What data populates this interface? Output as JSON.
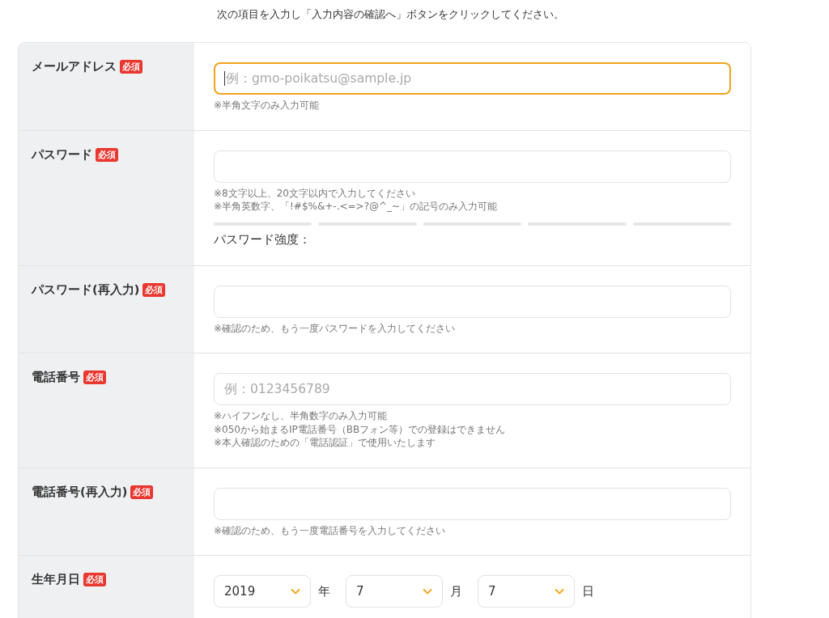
{
  "intro": "次の項目を入力し「入力内容の確認へ」ボタンをクリックしてください。",
  "fields": [
    {
      "kind": "text",
      "label": "メールアドレス",
      "badge": "必須",
      "placeholder": "例：gmo-poikatsu@sample.jp",
      "focused": true,
      "notes": [
        "※半角文字のみ入力可能"
      ]
    },
    {
      "kind": "password",
      "label": "パスワード",
      "badge": "必須",
      "focused": false,
      "notes": [
        "※8文字以上、20文字以内で入力してください",
        "※半角英数字、「!#$%&+-.<=>?@^_~」の記号のみ入力可能"
      ],
      "strength": {
        "label": "パスワード強度：",
        "level": 0
      }
    },
    {
      "kind": "text",
      "label": "パスワード(再入力)",
      "badge": "必須",
      "focused": false,
      "notes": [
        "※確認のため、もう一度パスワードを入力してください"
      ]
    },
    {
      "kind": "text",
      "label": "電話番号",
      "badge": "必須",
      "placeholder": "例：0123456789",
      "focused": false,
      "notes": [
        "※ハイフンなし、半角数字のみ入力可能",
        "※050から始まるIP電話番号（BBフォン等）での登録はできません",
        "※本人確認のための「電話認証」で使用いたします"
      ]
    },
    {
      "kind": "text",
      "label": "電話番号(再入力)",
      "badge": "必須",
      "focused": false,
      "notes": [
        "※確認のため、もう一度電話番号を入力してください"
      ]
    },
    {
      "kind": "date",
      "label": "生年月日",
      "badge": "必須",
      "selects": [
        {
          "value": "2019",
          "unit": "年"
        },
        {
          "value": "7",
          "unit": "月"
        },
        {
          "value": "7",
          "unit": "日"
        }
      ]
    }
  ]
}
